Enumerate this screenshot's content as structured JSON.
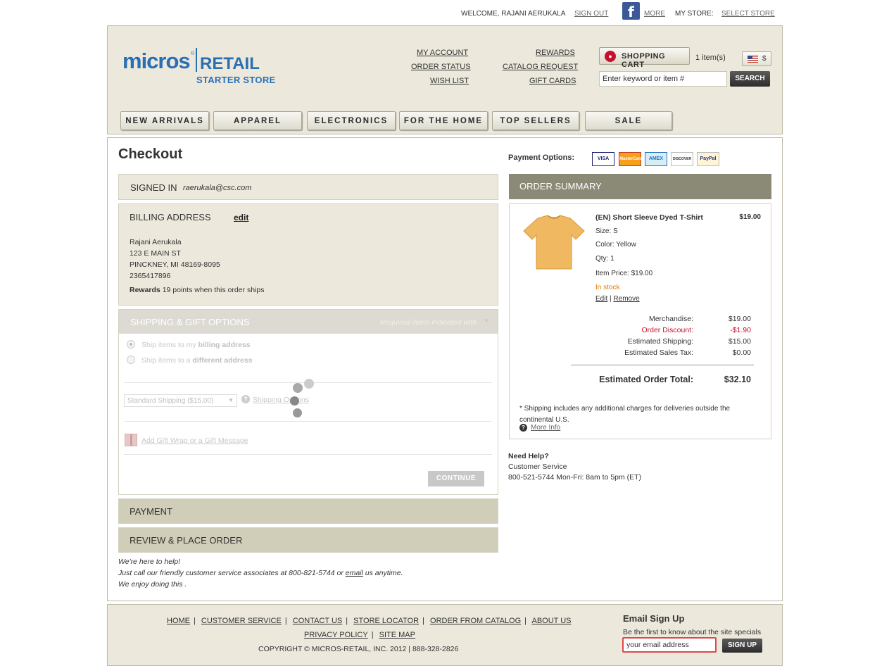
{
  "topbar": {
    "welcome": "WELCOME, RAJANI AERUKALA",
    "signout": "SIGN OUT",
    "facebook_glyph": "f",
    "more": "MORE",
    "mystore_label": "MY STORE:",
    "select_store": "SELECT STORE"
  },
  "logo": {
    "micros": "micros",
    "reg": "®",
    "retail": "RETAIL",
    "starter": "STARTER STORE"
  },
  "account_links": {
    "my_account": "MY ACCOUNT",
    "order_status": "ORDER STATUS",
    "wish_list": "WISH LIST",
    "rewards": "REWARDS",
    "catalog_request": "CATALOG REQUEST",
    "gift_cards": "GIFT CARDS"
  },
  "cart": {
    "label": "SHOPPING CART",
    "items": "1 item(s)",
    "currency": "$"
  },
  "search": {
    "value": "Enter keyword or item #",
    "button": "SEARCH"
  },
  "nav": [
    "NEW ARRIVALS",
    "APPAREL",
    "ELECTRONICS",
    "FOR THE HOME",
    "TOP SELLERS",
    "SALE"
  ],
  "checkout": {
    "title": "Checkout",
    "signed_in": {
      "heading": "SIGNED IN",
      "email": "raerukala@csc.com"
    },
    "billing": {
      "heading": "BILLING ADDRESS",
      "edit": "edit",
      "name": "Rajani Aerukala",
      "street": "123 E MAIN ST",
      "city": "PINCKNEY, MI 48169-8095",
      "phone": "2365417896",
      "rewards_label": "Rewards",
      "rewards_text": "19 points when this order ships"
    },
    "shipping": {
      "heading": "SHIPPING & GIFT OPTIONS",
      "required": "Required items indicated with",
      "required_mark": "*",
      "option1_prefix": "Ship items to my",
      "option1_bold": "billing address",
      "option2_prefix": "Ship items to a",
      "option2_bold": "different address",
      "method": "Standard Shipping ($15.00)",
      "help_glyph": "?",
      "shipping_options": "Shipping Options",
      "gift_link": "Add Gift Wrap or a Gift Message",
      "continue": "CONTINUE"
    },
    "payment": {
      "heading": "PAYMENT"
    },
    "review": {
      "heading": "REVIEW & PLACE ORDER"
    },
    "help": {
      "line1": "We're here to help!",
      "line2_prefix": "Just call our friendly customer service associates at 800-821-5744 or",
      "line2_link": "email",
      "line2_suffix": "us anytime.",
      "line3": "We enjoy doing this ."
    }
  },
  "payment_options": {
    "label": "Payment Options:",
    "cards": [
      "VISA",
      "MasterCard",
      "AMEX",
      "DISCOVER",
      "PayPal"
    ]
  },
  "summary": {
    "heading": "ORDER SUMMARY",
    "item": {
      "name": "(EN) Short Sleeve Dyed T-Shirt",
      "price": "$19.00",
      "size": "Size: S",
      "color": "Color: Yellow",
      "qty": "Qty: 1",
      "item_price": "Item Price: $19.00",
      "stock": "In stock",
      "edit": "Edit",
      "sep": "|",
      "remove": "Remove",
      "image_color": "#f0b860"
    },
    "merchandise_label": "Merchandise:",
    "merchandise": "$19.00",
    "discount_label": "Order Discount:",
    "discount": "-$1.90",
    "shipping_label": "Estimated Shipping:",
    "shipping": "$15.00",
    "tax_label": "Estimated Sales Tax:",
    "tax": "$0.00",
    "total_label": "Estimated Order Total:",
    "total": "$32.10",
    "note_line1": "* Shipping includes any additional charges for deliveries outside the",
    "note_line2": "continental U.S.",
    "more_info_glyph": "?",
    "more_info": "More Info"
  },
  "need_help": {
    "heading": "Need Help?",
    "line1": "Customer Service",
    "line2": "800-521-5744 Mon-Fri: 8am to 5pm (ET)"
  },
  "footer": {
    "links_row1": [
      "HOME",
      "CUSTOMER SERVICE",
      "CONTACT US",
      "STORE LOCATOR",
      "ORDER FROM CATALOG",
      "ABOUT US"
    ],
    "links_row2": [
      "PRIVACY POLICY",
      "SITE MAP"
    ],
    "copyright": "COPYRIGHT © MICROS-RETAIL, INC. 2012 | 888-328-2826",
    "email_heading": "Email Sign Up",
    "email_sub": "Be the first to know about the site specials",
    "email_value": "your email address",
    "signup": "SIGN UP"
  },
  "colors": {
    "brand_blue": "#2a6fb4",
    "header_bg": "#ece9dc",
    "summary_header": "#8b8a77",
    "discount_red": "#c8102e",
    "stock_orange": "#e07b00"
  }
}
